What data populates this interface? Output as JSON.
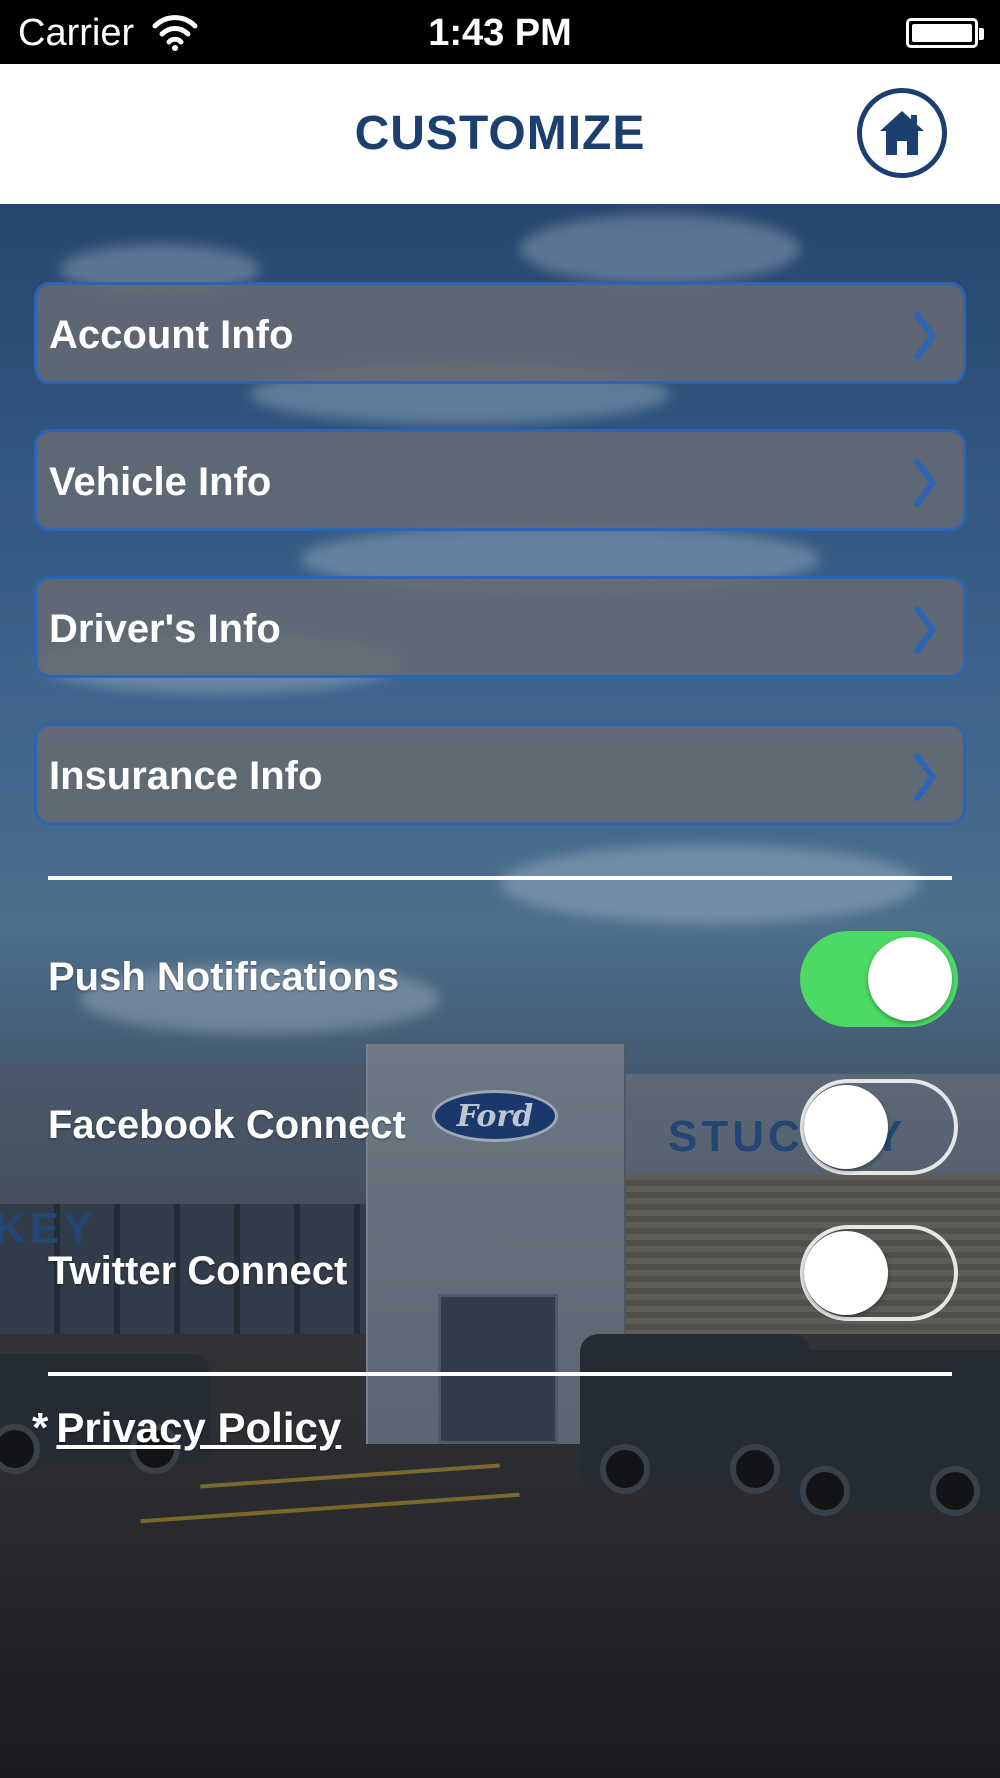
{
  "status_bar": {
    "carrier": "Carrier",
    "time": "1:43 PM",
    "wifi_icon": "wifi-icon",
    "battery_icon": "battery-icon"
  },
  "nav": {
    "title": "CUSTOMIZE",
    "home_icon": "home-icon",
    "accent_color": "#1b3f6e"
  },
  "menu": {
    "items": [
      {
        "label": "Account Info",
        "icon": "chevron-right-icon"
      },
      {
        "label": "Vehicle Info",
        "icon": "chevron-right-icon"
      },
      {
        "label": "Driver's Info",
        "icon": "chevron-right-icon"
      },
      {
        "label": "Insurance Info",
        "icon": "chevron-right-icon"
      }
    ],
    "border_color": "#2e64b4"
  },
  "toggles": [
    {
      "label": "Push Notifications",
      "on": true
    },
    {
      "label": "Facebook Connect",
      "on": false
    },
    {
      "label": "Twitter Connect",
      "on": false
    }
  ],
  "toggle_on_color": "#4cd964",
  "background_sign": {
    "left": "KEY",
    "right": "STUCKEY",
    "logo": "Ford"
  },
  "footer": {
    "asterisk": "*",
    "privacy_link": "Privacy Policy"
  }
}
